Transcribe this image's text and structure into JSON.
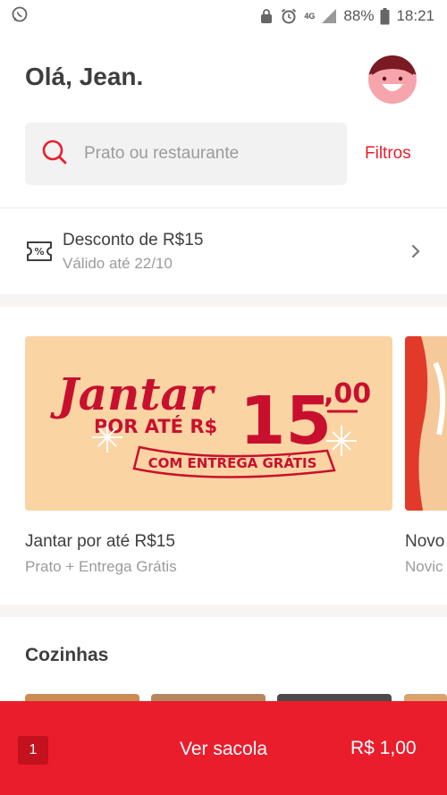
{
  "status_bar": {
    "network": "4G",
    "battery": "88%",
    "time": "18:21"
  },
  "header": {
    "greeting": "Olá, Jean."
  },
  "search": {
    "placeholder": "Prato ou restaurante",
    "filters_label": "Filtros"
  },
  "coupon": {
    "title": "Desconto de R$15",
    "subtitle": "Válido até 22/10"
  },
  "banner": {
    "script_word": "Jantar",
    "line2": "POR ATÉ R$",
    "amount": "15",
    "cents": ",00",
    "ribbon": "COM ENTREGA GRÁTIS"
  },
  "carousel": [
    {
      "title": "Jantar por até R$15",
      "subtitle": "Prato + Entrega Grátis"
    },
    {
      "title": "Novo",
      "subtitle": "Novic"
    }
  ],
  "section": {
    "title": "Cozinhas"
  },
  "bag": {
    "count": "1",
    "label": "Ver sacola",
    "total": "R$ 1,00"
  },
  "colors": {
    "brand_red": "#ea1d2c",
    "banner_bg": "#fbd4a4",
    "banner_text": "#c8102e"
  }
}
